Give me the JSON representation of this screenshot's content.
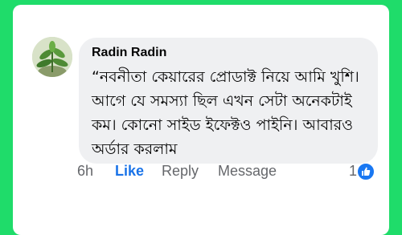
{
  "comment": {
    "author": "Radin Radin",
    "text": "“নবনীতা কেয়ারের প্রোডাক্ট নিয়ে আমি খুশি। আগে যে সমস্যা ছিল এখন সেটা অনেকটাই কম। কোনো সাইড ইফেক্টও পাইনি। আবারও অর্ডার করলাম"
  },
  "actions": {
    "time": "6h",
    "like": "Like",
    "reply": "Reply",
    "message": "Message",
    "reaction_count": "1"
  },
  "icons": {
    "reaction": "like-thumb-icon",
    "avatar": "plant-avatar"
  },
  "colors": {
    "background": "#1fdc6a",
    "like_blue": "#1a73e8",
    "bubble": "#eff0f2"
  }
}
